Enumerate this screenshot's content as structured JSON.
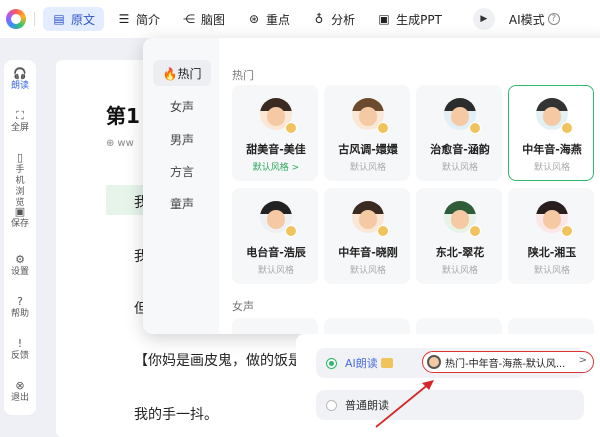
{
  "toolbar": {
    "tabs": [
      {
        "label": "原文",
        "icon": "doc-icon"
      },
      {
        "label": "简介",
        "icon": "list-icon"
      },
      {
        "label": "脑图",
        "icon": "mindmap-icon"
      },
      {
        "label": "重点",
        "icon": "target-icon"
      },
      {
        "label": "分析",
        "icon": "bulb-icon"
      },
      {
        "label": "生成PPT",
        "icon": "ppt-icon"
      }
    ],
    "ai_mode_label": "AI模式",
    "help_mark": "?"
  },
  "sidebar": {
    "items": [
      {
        "label": "朗读",
        "icon": "headphones-icon"
      },
      {
        "label": "全屏",
        "icon": "fullscreen-icon"
      },
      {
        "label": "手机浏览",
        "icon": "phone-icon"
      },
      {
        "label": "保存",
        "icon": "save-icon"
      },
      {
        "label": "设置",
        "icon": "gear-icon"
      },
      {
        "label": "帮助",
        "icon": "help-icon"
      },
      {
        "label": "反馈",
        "icon": "feedback-icon"
      },
      {
        "label": "退出",
        "icon": "exit-icon"
      }
    ]
  },
  "doc": {
    "title": "第1",
    "url": "ww",
    "lines": [
      "我",
      "我",
      "但",
      "【你妈是画皮鬼，做的饭是",
      "我的手一抖。"
    ]
  },
  "voice_popup": {
    "categories": [
      "🔥热门",
      "女声",
      "男声",
      "方言",
      "童声"
    ],
    "section_hot": "热门",
    "section_female": "女声",
    "voices": [
      {
        "name": "甜美音-美佳",
        "style": "默认风格 >"
      },
      {
        "name": "古风调-嬛嬛",
        "style": "默认风格"
      },
      {
        "name": "治愈音-涵韵",
        "style": "默认风格"
      },
      {
        "name": "中年音-海燕",
        "style": "默认风格"
      },
      {
        "name": "电台音-浩辰",
        "style": "默认风格"
      },
      {
        "name": "中年音-晓刚",
        "style": "默认风格"
      },
      {
        "name": "东北-翠花",
        "style": "默认风格"
      },
      {
        "name": "陕北-湘玉",
        "style": "默认风格"
      }
    ]
  },
  "read_options": {
    "ai_label": "AI朗读",
    "ai_selection": "热门-中年音-海燕-默认风...",
    "normal_label": "普通朗读"
  }
}
